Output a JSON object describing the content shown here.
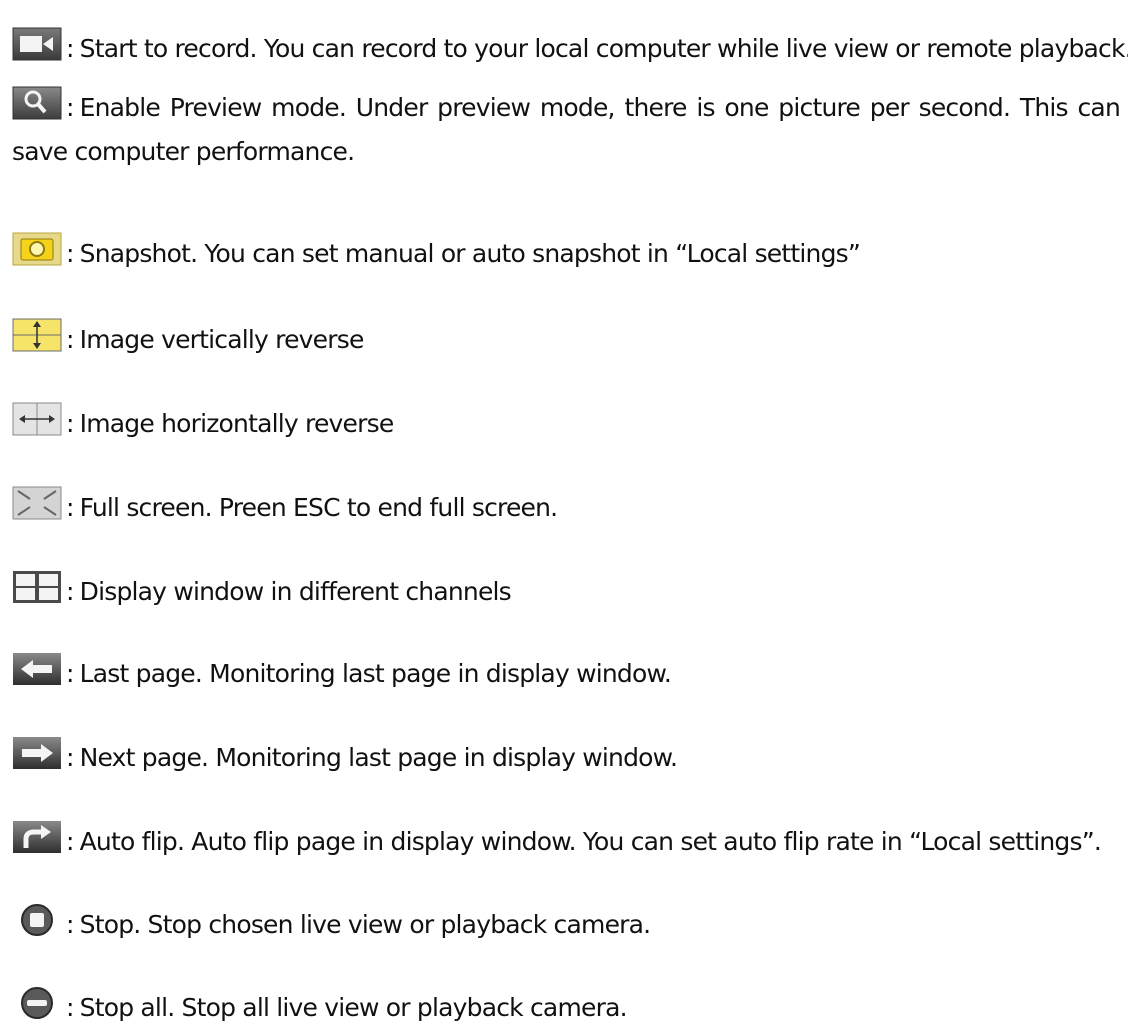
{
  "separator": ":",
  "entries": [
    {
      "icon": "record-camera-icon",
      "text": "Start to record. You can record to your local computer while live view or remote playback."
    },
    {
      "icon": "preview-magnifier-icon",
      "text": "Enable Preview mode. Under preview mode, there is one picture per second. This can save computer performance."
    },
    {
      "icon": "snapshot-camera-icon",
      "text": "Snapshot. You can set manual or auto snapshot in “Local settings”"
    },
    {
      "icon": "vertical-reverse-icon",
      "text": "Image vertically reverse"
    },
    {
      "icon": "horizontal-reverse-icon",
      "text": "Image horizontally reverse"
    },
    {
      "icon": "fullscreen-icon",
      "text": "Full screen. Preen ESC to end full screen."
    },
    {
      "icon": "multi-window-icon",
      "text": "Display window in different channels"
    },
    {
      "icon": "last-page-arrow-icon",
      "text": "Last page. Monitoring last page in display window."
    },
    {
      "icon": "next-page-arrow-icon",
      "text": "Next page. Monitoring last page in display window."
    },
    {
      "icon": "auto-flip-icon",
      "text": "Auto flip. Auto flip page in display window. You can set auto flip rate in “Local settings”."
    },
    {
      "icon": "stop-icon",
      "text": "Stop. Stop chosen live view or playback camera."
    },
    {
      "icon": "stop-all-icon",
      "text": "Stop all. Stop all live view or playback camera."
    }
  ],
  "colors": {
    "text": "#111111",
    "icon_gray_dark": "#555555",
    "icon_gray_light": "#d8d8d8",
    "icon_yellow": "#f0d000"
  }
}
